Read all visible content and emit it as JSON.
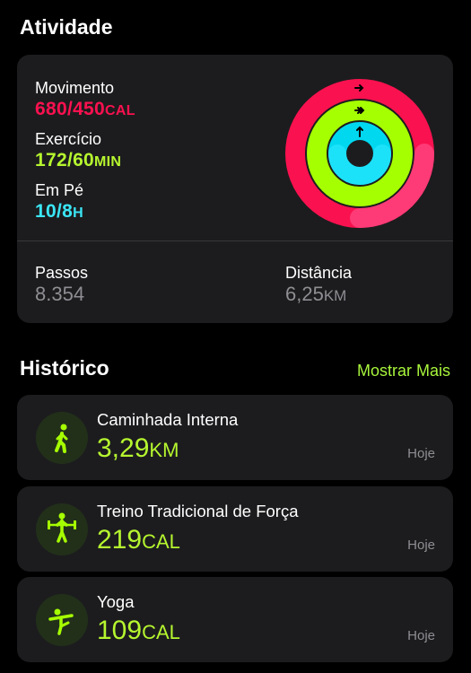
{
  "activity": {
    "title": "Atividade",
    "move": {
      "label": "Movimento",
      "value": "680/450",
      "unit": "CAL",
      "progress": 1.511
    },
    "exercise": {
      "label": "Exercício",
      "value": "172/60",
      "unit": "MIN",
      "progress": 2.867
    },
    "stand": {
      "label": "Em Pé",
      "value": "10/8",
      "unit": "H",
      "progress": 1.25
    },
    "steps": {
      "label": "Passos",
      "value": "8.354"
    },
    "distance": {
      "label": "Distância",
      "value": "6,25",
      "unit": "KM"
    },
    "colors": {
      "move": "#fa114f",
      "exercise": "#a6ff00",
      "stand": "#00d8f0"
    }
  },
  "history": {
    "title": "Histórico",
    "show_more": "Mostrar Mais",
    "items": [
      {
        "name": "Caminhada Interna",
        "value": "3,29",
        "unit": "KM",
        "date": "Hoje",
        "icon": "walking-icon"
      },
      {
        "name": "Treino Tradicional de Força",
        "value": "219",
        "unit": "CAL",
        "date": "Hoje",
        "icon": "weightlifting-icon"
      },
      {
        "name": "Yoga",
        "value": "109",
        "unit": "CAL",
        "date": "Hoje",
        "icon": "yoga-icon"
      }
    ]
  }
}
